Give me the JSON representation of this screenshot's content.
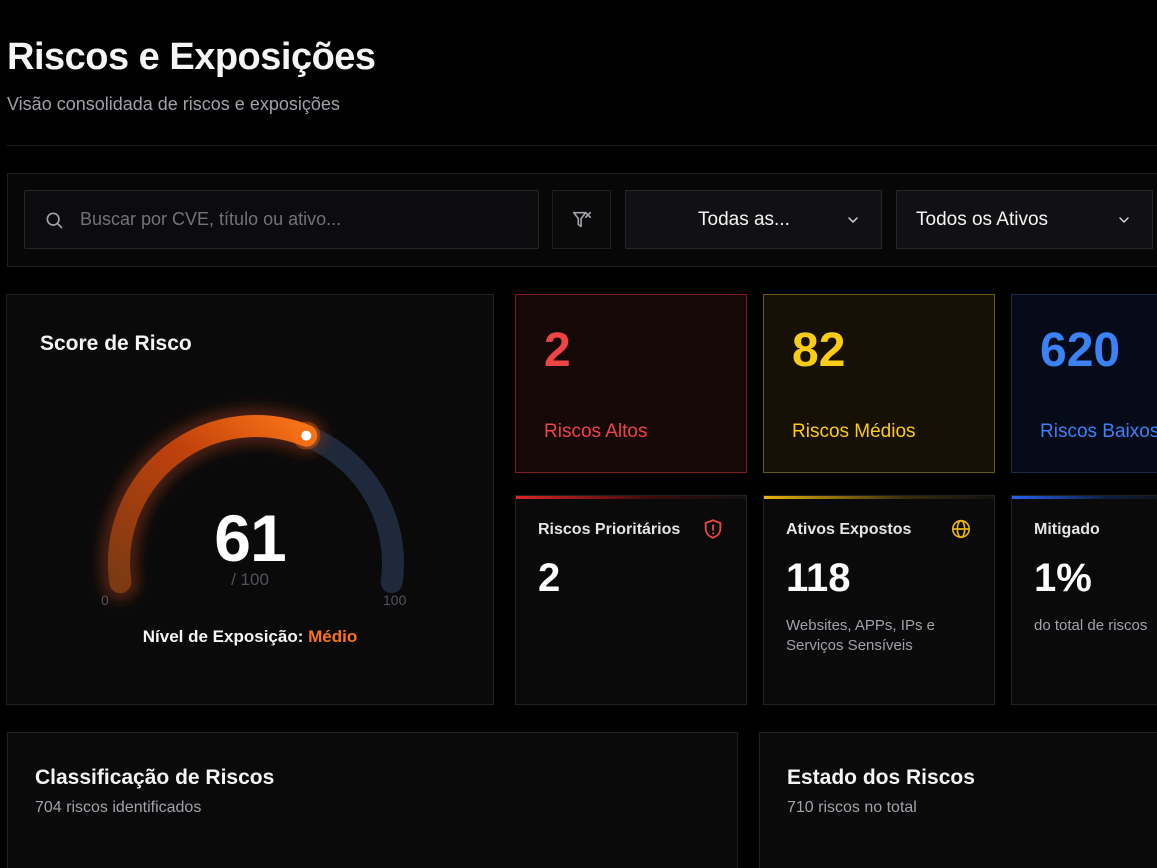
{
  "header": {
    "title": "Riscos e Exposições",
    "subtitle": "Visão consolidada de riscos e exposições"
  },
  "filters": {
    "search_placeholder": "Buscar por CVE, título ou ativo...",
    "search_value": "",
    "category_select": "Todas as...",
    "asset_select": "Todos os Ativos"
  },
  "score": {
    "title": "Score de Risco",
    "value": "61",
    "max_label": "/ 100",
    "min_tick": "0",
    "max_tick": "100",
    "fraction": 0.61,
    "exposure_label": "Nível de Exposição:",
    "exposure_level": "Médio",
    "colors": {
      "fill": "#f97316",
      "track": "#1e293b"
    }
  },
  "stats": {
    "high": {
      "value": "2",
      "label": "Riscos Altos",
      "color": "#ef4444"
    },
    "medium": {
      "value": "82",
      "label": "Riscos Médios",
      "color": "#facc15"
    },
    "low": {
      "value": "620",
      "label": "Riscos Baixos",
      "color": "#3b82f6"
    }
  },
  "info": {
    "priority": {
      "title": "Riscos Prioritários",
      "value": "2",
      "icon": "shield-alert-icon"
    },
    "exposed": {
      "title": "Ativos Expostos",
      "value": "118",
      "description": "Websites, APPs, IPs e Serviços Sensíveis",
      "icon": "globe-icon"
    },
    "mitigated": {
      "title": "Mitigado",
      "value": "1%",
      "description": "do total de riscos"
    }
  },
  "sections": {
    "classification": {
      "title": "Classificação de Riscos",
      "subtitle": "704 riscos identificados"
    },
    "state": {
      "title": "Estado dos Riscos",
      "subtitle": "710 riscos no total"
    }
  }
}
